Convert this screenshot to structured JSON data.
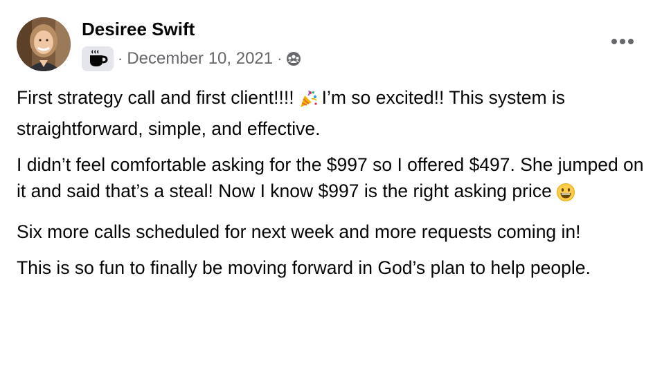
{
  "post": {
    "author": "Desiree Swift",
    "badge_icon": "coffee-cup-icon",
    "separator": "·",
    "date": "December 10, 2021",
    "privacy_icon": "group-audience-icon",
    "more_icon": "more-options-icon",
    "paragraphs": [
      {
        "text_before": "First strategy call and first client!!!!",
        "emoji": "party-popper-icon",
        "text_after": "I’m so excited!! This system is straightforward, simple, and effective."
      },
      {
        "text_before": "I didn’t feel comfortable asking for the $997 so I offered $497. She jumped on it and said that’s a steal! Now I know $997 is the right asking price",
        "emoji": "grinning-face-icon",
        "text_after": ""
      },
      {
        "text": "Six more calls scheduled for next week and more requests coming in!"
      },
      {
        "text": "This is so fun to finally be moving forward in God’s plan to help people."
      }
    ]
  },
  "colors": {
    "text": "#050505",
    "secondary_text": "#65676b",
    "badge_bg": "#e4e6eb"
  }
}
